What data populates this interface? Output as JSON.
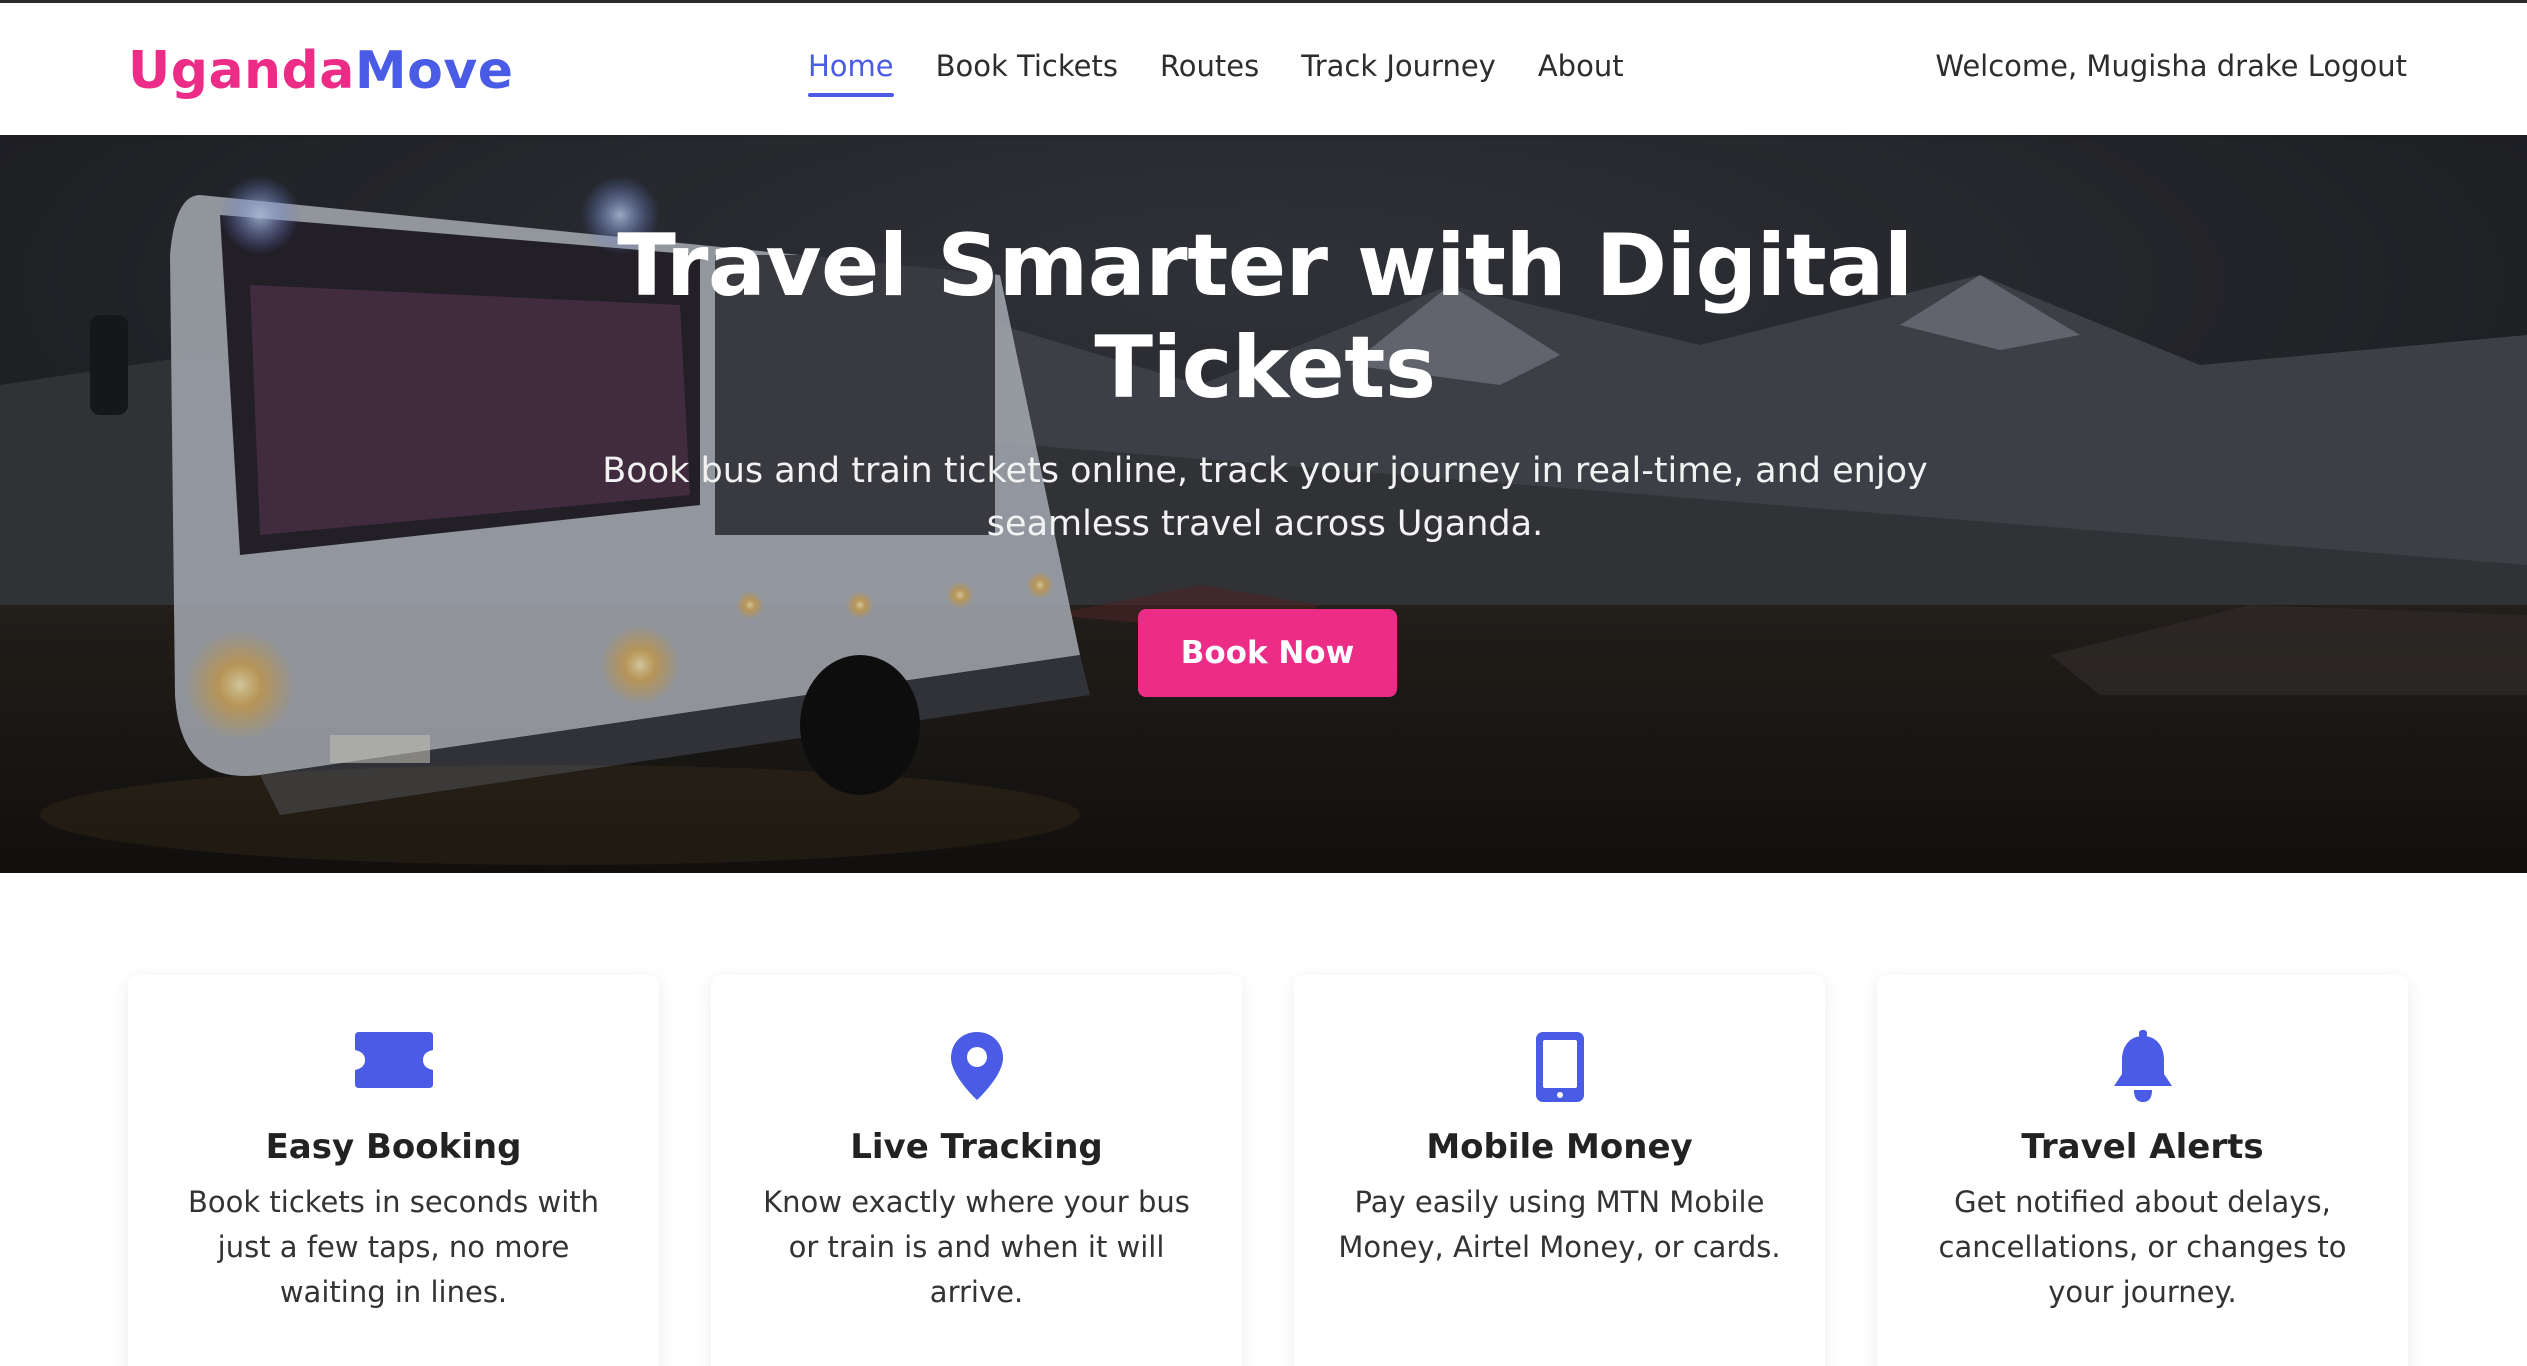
{
  "brand": {
    "part1": "Uganda",
    "part2": "Move",
    "color1": "#ec2c86",
    "color2": "#4a5be6"
  },
  "nav": {
    "items": [
      {
        "label": "Home",
        "active": true
      },
      {
        "label": "Book Tickets",
        "active": false
      },
      {
        "label": "Routes",
        "active": false
      },
      {
        "label": "Track Journey",
        "active": false
      },
      {
        "label": "About",
        "active": false
      }
    ],
    "welcome": "Welcome, Mugisha drake",
    "logout": "Logout"
  },
  "hero": {
    "title": "Travel Smarter with Digital Tickets",
    "subtitle": "Book bus and train tickets online, track your journey in real-time, and enjoy seamless travel across Uganda.",
    "cta": "Book Now"
  },
  "features": [
    {
      "icon": "ticket-icon",
      "title": "Easy Booking",
      "text": "Book tickets in seconds with just a few taps, no more waiting in lines."
    },
    {
      "icon": "map-pin-icon",
      "title": "Live Tracking",
      "text": "Know exactly where your bus or train is and when it will arrive."
    },
    {
      "icon": "mobile-phone-icon",
      "title": "Mobile Money",
      "text": "Pay easily using MTN Mobile Money, Airtel Money, or cards."
    },
    {
      "icon": "bell-icon",
      "title": "Travel Alerts",
      "text": "Get notified about delays, cancellations, or changes to your journey."
    }
  ],
  "colors": {
    "accent": "#4a5be6",
    "cta": "#ec2c86"
  }
}
